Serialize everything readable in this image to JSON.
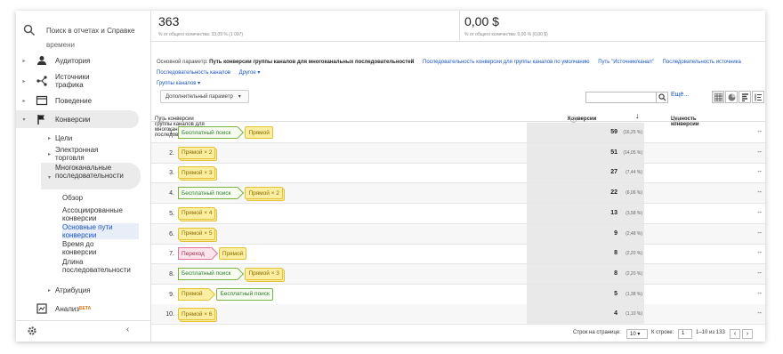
{
  "sidebar": {
    "search_placeholder": "Поиск в отчетах и Справке",
    "cut_top": "времени",
    "items": [
      {
        "label": "Аудитория",
        "icon": "person-icon"
      },
      {
        "label": "Источники трафика",
        "icon": "acquisition-icon"
      },
      {
        "label": "Поведение",
        "icon": "behavior-icon"
      },
      {
        "label": "Конверсии",
        "icon": "flag-icon"
      }
    ],
    "sub": {
      "goals": "Цели",
      "ecommerce": "Электронная торговля",
      "mcf": "Многоканальные последовательности",
      "overview": "Обзор",
      "assisted": "Ассоциированные конверсии",
      "top_paths": "Основные пути конверсии",
      "time_lag": "Время до конверсии",
      "path_length": "Длина последовательности",
      "attribution": "Атрибуция"
    },
    "analysis": "Анализ",
    "beta": "БЕТА"
  },
  "metrics": [
    {
      "value": "363",
      "sub": "% от общего количества: 33,09 % (1 097)"
    },
    {
      "value": "0,00 $",
      "sub": "% от общего количества: 0,00 % (0,00 $)"
    }
  ],
  "dims": {
    "label": "Основной параметр:",
    "selected": "Путь конверсии группы каналов для многоканальных последовательностей",
    "links": [
      "Последовательность конверсии для группы каналов по умолчанию",
      "Путь \"Источник/канал\"",
      "Последовательность источника",
      "Последовательность каналов",
      "Другое",
      "Группы каналов"
    ]
  },
  "controls": {
    "secondary": "Дополнительный параметр",
    "more": "Ещё..."
  },
  "table": {
    "headers": {
      "path": "Путь конверсии группы каналов для многоканальных последовательностей",
      "conv": "Конверсии",
      "value": "Ценность конверсии"
    },
    "rows": [
      {
        "n": "1.",
        "chips": [
          {
            "t": "Бесплатный поиск",
            "c": "green"
          },
          {
            "t": "Прямой",
            "c": "yellow"
          }
        ],
        "conv": "59",
        "pct": "(16,25 %)",
        "val": "--"
      },
      {
        "n": "2.",
        "chips": [
          {
            "t": "Прямой × 2",
            "c": "yellow"
          }
        ],
        "conv": "51",
        "pct": "(14,05 %)",
        "val": "--"
      },
      {
        "n": "3.",
        "chips": [
          {
            "t": "Прямой × 3",
            "c": "yellow"
          }
        ],
        "conv": "27",
        "pct": "(7,44 %)",
        "val": "--"
      },
      {
        "n": "4.",
        "chips": [
          {
            "t": "Бесплатный поиск",
            "c": "green"
          },
          {
            "t": "Прямой × 2",
            "c": "yellow"
          }
        ],
        "conv": "22",
        "pct": "(6,06 %)",
        "val": "--"
      },
      {
        "n": "5.",
        "chips": [
          {
            "t": "Прямой × 4",
            "c": "yellow"
          }
        ],
        "conv": "13",
        "pct": "(3,58 %)",
        "val": "--"
      },
      {
        "n": "6.",
        "chips": [
          {
            "t": "Прямой × 5",
            "c": "yellow"
          }
        ],
        "conv": "9",
        "pct": "(2,48 %)",
        "val": "--"
      },
      {
        "n": "7.",
        "chips": [
          {
            "t": "Переход",
            "c": "pink"
          },
          {
            "t": "Прямой",
            "c": "yellow"
          }
        ],
        "conv": "8",
        "pct": "(2,20 %)",
        "val": "--"
      },
      {
        "n": "8.",
        "chips": [
          {
            "t": "Бесплатный поиск",
            "c": "green"
          },
          {
            "t": "Прямой × 3",
            "c": "yellow"
          }
        ],
        "conv": "8",
        "pct": "(2,20 %)",
        "val": "--"
      },
      {
        "n": "9.",
        "chips": [
          {
            "t": "Прямой",
            "c": "yellow"
          },
          {
            "t": "Бесплатный поиск",
            "c": "green"
          }
        ],
        "conv": "5",
        "pct": "(1,38 %)",
        "val": "--"
      },
      {
        "n": "10.",
        "chips": [
          {
            "t": "Прямой × 6",
            "c": "yellow"
          }
        ],
        "conv": "4",
        "pct": "(1,10 %)",
        "val": "--"
      }
    ]
  },
  "pager": {
    "rows_label": "Строк на странице:",
    "rows_value": "10",
    "goto_label": "К строке:",
    "goto_value": "1",
    "range": "1–10 из 133"
  }
}
